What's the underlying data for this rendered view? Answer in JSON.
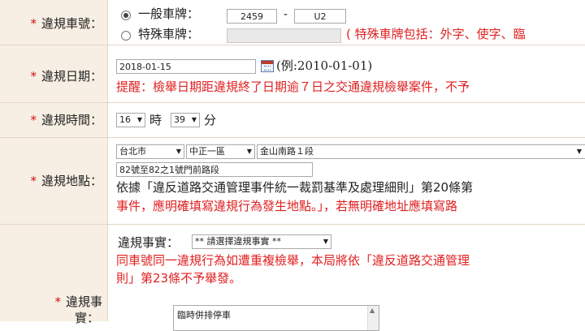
{
  "plate": {
    "label": "違規車號：",
    "general_label": "一般車牌：",
    "plate_part1": "2459",
    "dash": "-",
    "plate_part2": "U2",
    "special_label": "特殊車牌：",
    "special_hint": "( 特殊車牌包括：外字、使字、臨"
  },
  "date": {
    "label": "違規日期：",
    "value": "2018-01-15",
    "example": "(例:2010-01-01)",
    "reminder": "提醒：檢舉日期距違規終了日期逾７日之交通違規檢舉案件，不予"
  },
  "time": {
    "label": "違規時間：",
    "hour": "16",
    "hour_unit": "時",
    "minute": "39",
    "minute_unit": "分"
  },
  "location": {
    "label": "違規地點：",
    "city": "台北市",
    "district": "中正一區",
    "road": "金山南路１段",
    "address": "82號至82之1號門前路段",
    "note1": "依據「違反道路交通管理事件統一裁罰基準及處理細則」第20條第",
    "note2": "事件，應明確填寫違規行為發生地點。」，若無明確地址應填寫路"
  },
  "fact": {
    "label_line1": "違規事",
    "label_line2": "實：",
    "select_label": "違規事實：",
    "select_value": "** 請選擇違規事實 **",
    "warning1": "同車號同一違規行為如遭重複檢舉，本局將依「違反道路交通管理",
    "warning2": "則」第23條不予舉發。",
    "list_first": "臨時併排停車"
  }
}
